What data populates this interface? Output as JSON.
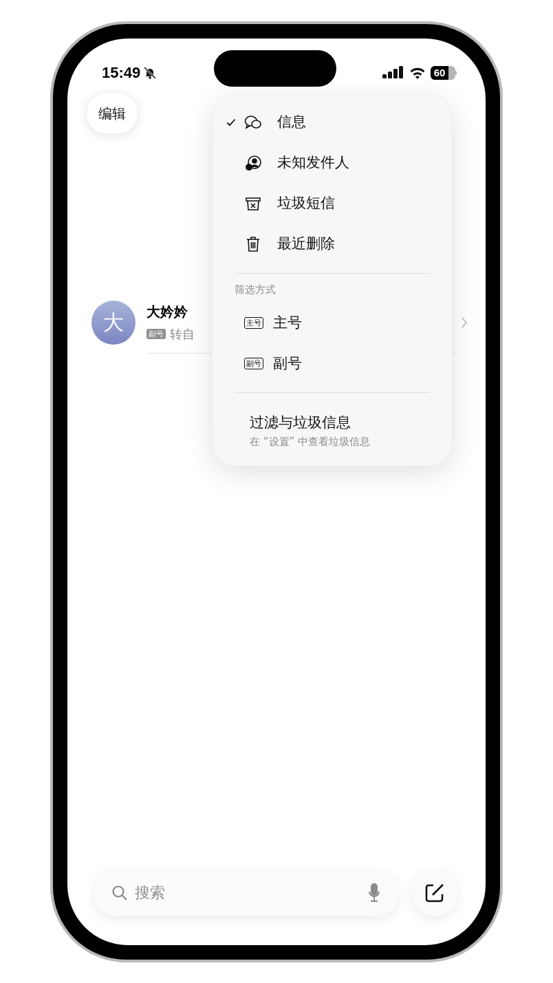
{
  "status_bar": {
    "time": "15:49",
    "battery": "60"
  },
  "edit_button": "编辑",
  "conversations": [
    {
      "avatar": "大",
      "name": "大妗妗",
      "line_badge": "副号",
      "preview": "转自"
    }
  ],
  "menu": {
    "items": [
      {
        "label": "信息",
        "kind": "messages",
        "selected": true
      },
      {
        "label": "未知发件人",
        "kind": "unknown",
        "selected": false
      },
      {
        "label": "垃圾短信",
        "kind": "junk",
        "selected": false
      },
      {
        "label": "最近删除",
        "kind": "trash",
        "selected": false
      }
    ],
    "filter_heading": "筛选方式",
    "filters": [
      {
        "label": "主号",
        "badge": "主号"
      },
      {
        "label": "副号",
        "badge": "副号"
      }
    ],
    "footer": {
      "title": "过滤与垃圾信息",
      "subtitle": "在 “设置” 中查看垃圾信息"
    }
  },
  "search": {
    "placeholder": "搜索"
  }
}
